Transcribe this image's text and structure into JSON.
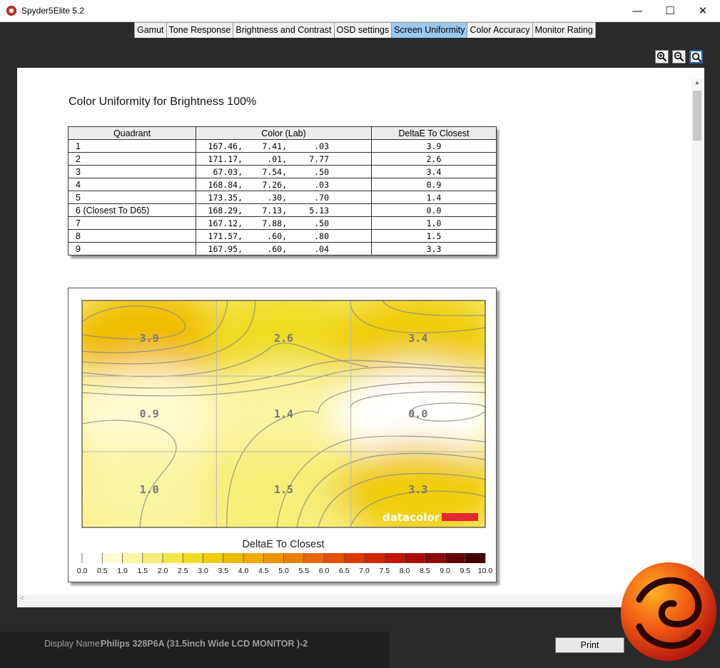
{
  "window": {
    "title": "Spyder5Elite 5.2",
    "minimize": "—",
    "maximize": "☐",
    "close": "✕"
  },
  "tabs": [
    {
      "label": "Gamut",
      "active": false
    },
    {
      "label": "Tone Response",
      "active": false
    },
    {
      "label": "Brightness and Contrast",
      "active": false
    },
    {
      "label": "OSD settings",
      "active": false
    },
    {
      "label": "Screen Uniformity",
      "active": true
    },
    {
      "label": "Color Accuracy",
      "active": false
    },
    {
      "label": "Monitor Rating",
      "active": false
    }
  ],
  "zoom": {
    "zoom_in_icon": "zoom-in-icon",
    "zoom_out_icon": "zoom-out-icon",
    "zoom_fit_icon": "zoom-fit-icon"
  },
  "report": {
    "title": "Color Uniformity for Brightness 100%",
    "table": {
      "headers": [
        "Quadrant",
        "Color (Lab)",
        "DeltaE To Closest"
      ],
      "rows": [
        {
          "quadrant": "1",
          "lab": [
            "167.46,",
            "7.41,",
            ".03"
          ],
          "delta": "3.9"
        },
        {
          "quadrant": "2",
          "lab": [
            "171.17,",
            ".01,",
            "7.77"
          ],
          "delta": "2.6"
        },
        {
          "quadrant": "3",
          "lab": [
            "67.03,",
            "7.54,",
            ".50"
          ],
          "delta": "3.4"
        },
        {
          "quadrant": "4",
          "lab": [
            "168.84,",
            "7.26,",
            ".03"
          ],
          "delta": "0.9"
        },
        {
          "quadrant": "5",
          "lab": [
            "173.35,",
            ".30,",
            ".70"
          ],
          "delta": "1.4"
        },
        {
          "quadrant": "6 (Closest To D65)",
          "lab": [
            "168.29,",
            "7.13,",
            "5.13"
          ],
          "delta": "0.0"
        },
        {
          "quadrant": "7",
          "lab": [
            "167.12,",
            "7.88,",
            ".50"
          ],
          "delta": "1.0"
        },
        {
          "quadrant": "8",
          "lab": [
            "171.57,",
            ".60,",
            ".80"
          ],
          "delta": "1.5"
        },
        {
          "quadrant": "9",
          "lab": [
            "167.95,",
            ".60,",
            ".04"
          ],
          "delta": "3.3"
        }
      ]
    }
  },
  "chart_data": {
    "type": "heatmap",
    "title": "DeltaE To Closest",
    "grid": {
      "rows": 3,
      "cols": 3
    },
    "cells": [
      {
        "row": 0,
        "col": 0,
        "value": 3.9,
        "label": "3.9"
      },
      {
        "row": 0,
        "col": 1,
        "value": 2.6,
        "label": "2.6"
      },
      {
        "row": 0,
        "col": 2,
        "value": 3.4,
        "label": "3.4"
      },
      {
        "row": 1,
        "col": 0,
        "value": 0.9,
        "label": "0.9"
      },
      {
        "row": 1,
        "col": 1,
        "value": 1.4,
        "label": "1.4"
      },
      {
        "row": 1,
        "col": 2,
        "value": 0.0,
        "label": "0.0"
      },
      {
        "row": 2,
        "col": 0,
        "value": 1.0,
        "label": "1.0"
      },
      {
        "row": 2,
        "col": 1,
        "value": 1.5,
        "label": "1.5"
      },
      {
        "row": 2,
        "col": 2,
        "value": 3.3,
        "label": "3.3"
      }
    ],
    "scale": {
      "min": 0,
      "max": 10,
      "ticks": [
        "0.0",
        "0.5",
        "1.0",
        "1.5",
        "2.0",
        "2.5",
        "3.0",
        "3.5",
        "4.0",
        "4.5",
        "5.0",
        "5.5",
        "6.0",
        "6.5",
        "7.0",
        "7.5",
        "8.0",
        "8.5",
        "9.0",
        "9.5",
        "10.0"
      ],
      "colors": [
        "#ffffff",
        "#fffbd2",
        "#fbf5a4",
        "#f6ee78",
        "#f2e64e",
        "#efdc24",
        "#f0cd08",
        "#f0bc04",
        "#efaa03",
        "#ec9402",
        "#e97e02",
        "#e66702",
        "#e35002",
        "#dc3a02",
        "#d22602",
        "#c21602",
        "#a80c03",
        "#880804",
        "#660404",
        "#400202"
      ]
    },
    "watermark": "datacolor",
    "watermark_color": "#e3262f"
  },
  "status": {
    "label": "Display Name:",
    "value": "Philips 328P6A (31.5inch Wide LCD MONITOR )-2"
  },
  "buttons": {
    "print": "Print"
  }
}
